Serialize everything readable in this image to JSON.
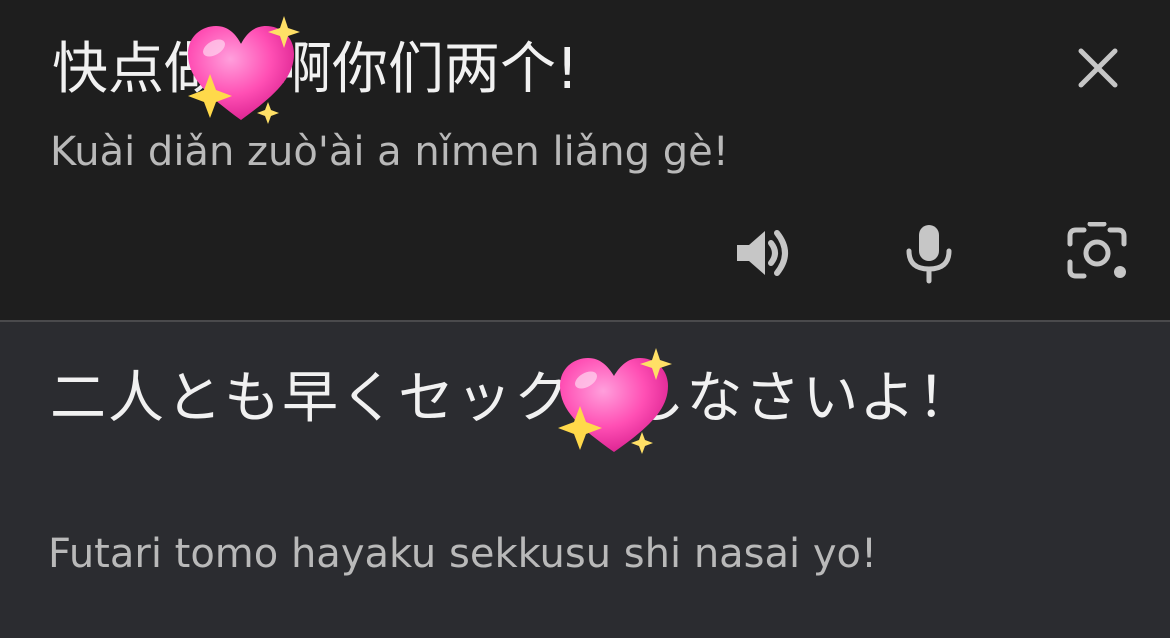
{
  "source": {
    "text": "快点做爱啊你们两个!",
    "romanization": "Kuài diǎn zuò'ài a nǐmen liǎng gè!"
  },
  "target": {
    "text": "二人とも早くセックスしなさいよ！",
    "romanization": "Futari tomo hayaku sekkusu shi nasai yo!"
  },
  "controls": {
    "close_icon": "close-icon",
    "speaker_icon": "speaker-icon",
    "mic_icon": "microphone-icon",
    "camera_icon": "camera-lens-icon"
  },
  "stickers": [
    "sparkling-heart",
    "sparkling-heart"
  ],
  "colors": {
    "top_panel": "#1e1e1e",
    "bottom_panel": "#2b2c30",
    "primary_text": "#f1f1f1",
    "secondary_text": "#b9b9b9",
    "icon": "#c6c6c6",
    "heart": "#ff4fb4"
  }
}
